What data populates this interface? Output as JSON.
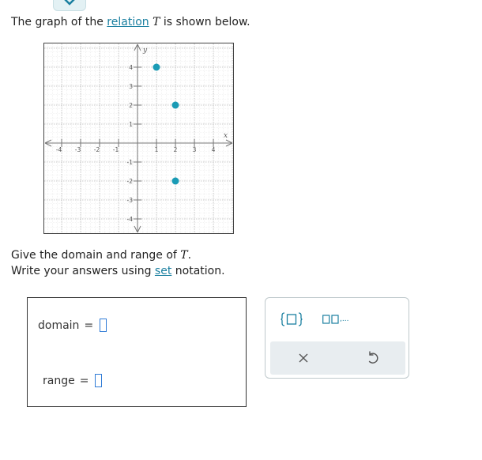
{
  "prompt": {
    "intro_before": "The graph of the ",
    "relation_link": "relation",
    "relation_var": "T",
    "intro_after": " is shown below."
  },
  "graph": {
    "x_axis_label": "x",
    "y_axis_label": "y",
    "x_tick_labels": [
      "-4",
      "-3",
      "-2",
      "-1",
      "1",
      "2",
      "3",
      "4"
    ],
    "y_tick_labels": [
      "4",
      "3",
      "2",
      "1",
      "-1",
      "-2",
      "-3",
      "-4"
    ],
    "x_range": [
      -5,
      5
    ],
    "y_range": [
      -5,
      5
    ],
    "grid": true,
    "dot_color": "#1a9bb5",
    "points": [
      {
        "x": 1,
        "y": 4
      },
      {
        "x": 2,
        "y": 2
      },
      {
        "x": 2,
        "y": -2
      }
    ]
  },
  "instructions": {
    "line1_before": "Give the domain and range of ",
    "line1_var": "T",
    "line1_after": ".",
    "line2_before": "Write your answers using ",
    "line2_link": "set",
    "line2_after": " notation."
  },
  "answer": {
    "domain_label": "domain",
    "range_label": "range",
    "equals": "=",
    "domain_value": "",
    "range_value": ""
  },
  "toolbox": {
    "set_braces_icon": "set-braces-icon",
    "list_icon": "comma-list-icon",
    "list_glyph_suffix": ",...",
    "clear_icon": "close-icon",
    "clear_glyph": "×",
    "undo_icon": "undo-icon",
    "accent": "#1a7fa0"
  }
}
